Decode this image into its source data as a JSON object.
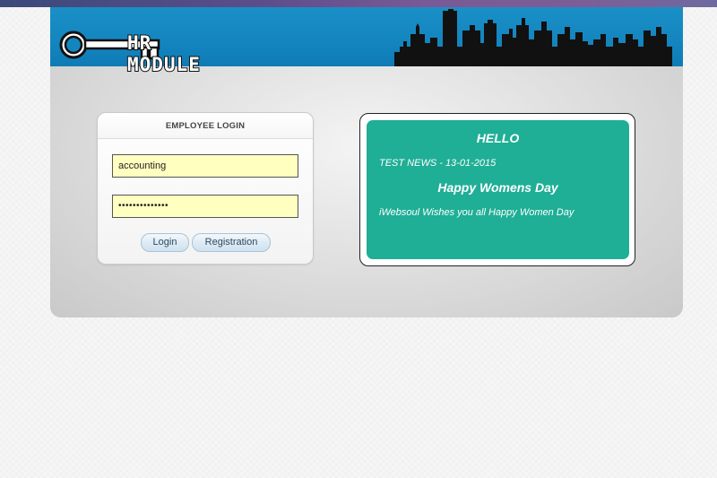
{
  "header": {
    "logo_text": "HR MODULE",
    "logo_icon": "key-icon",
    "skyline_icon": "city-skyline-icon",
    "colors": {
      "header_blue": "#1485bf",
      "top_bar": "#5a4d8a"
    }
  },
  "login": {
    "title": "EMPLOYEE LOGIN",
    "username_value": "accounting",
    "password_mask": "••••••••••••••",
    "login_label": "Login",
    "registration_label": "Registration",
    "field_color": "#ffffc0"
  },
  "news": {
    "greeting": "HELLO",
    "headline_date": "TEST NEWS - 13-01-2015",
    "title": "Happy Womens Day",
    "message": "iWebsoul Wishes you all Happy Women Day",
    "background_color": "#1fae96"
  }
}
